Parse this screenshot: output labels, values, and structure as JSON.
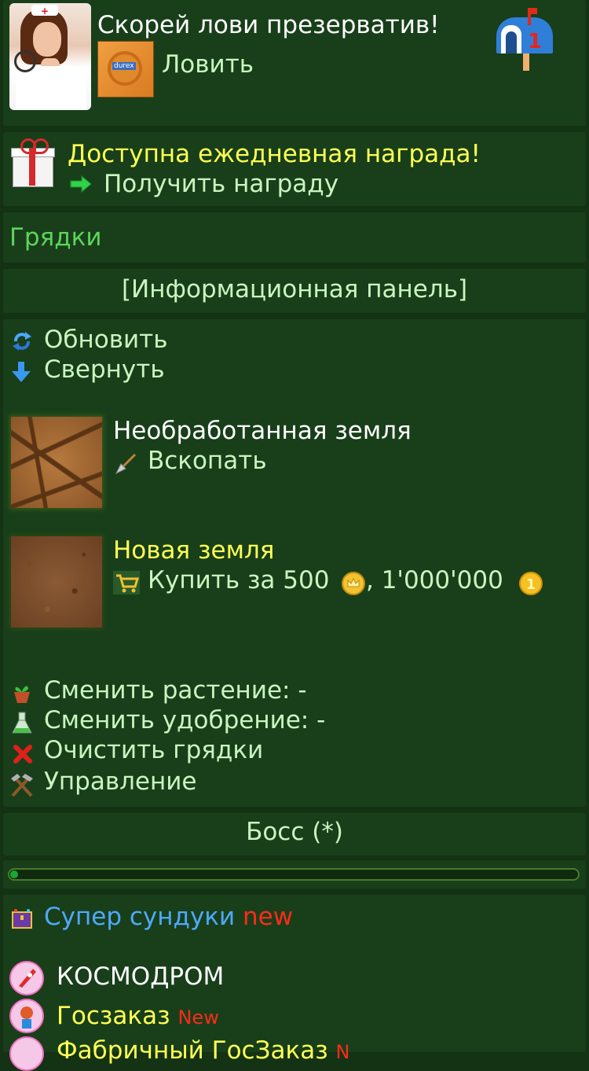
{
  "header": {
    "title": "Скорей лови презерватив!",
    "catch_label": "Ловить",
    "condom_brand": "durex",
    "mail_count": "1"
  },
  "daily": {
    "title": "Доступна ежедневная награда!",
    "link": "Получить награду"
  },
  "section_title": "Грядки",
  "info_panel_label": "[Информационная панель]",
  "actions": {
    "refresh": "Обновить",
    "collapse": "Свернуть"
  },
  "plots": [
    {
      "title": "Необработанная земля",
      "action": "Вскопать"
    },
    {
      "title": "Новая земля",
      "action_prefix": "Купить за 500",
      "action_mid": ", 1'000'000"
    }
  ],
  "bed_actions": {
    "change_plant": "Сменить растение: -",
    "change_fertilizer": "Сменить удобрение: -",
    "clear": "Очистить грядки",
    "manage": "Управление"
  },
  "boss": {
    "label": "Босс (*)",
    "progress": 0.012
  },
  "menu": {
    "super_chests": "Супер сундуки",
    "super_chests_badge": "new",
    "cosmodrome": "КОСМОДРОМ",
    "goszakaz": "Госзаказ",
    "goszakaz_badge": "New",
    "factory": "Фабричный ГосЗаказ",
    "factory_badge": "N"
  },
  "colors": {
    "background": "#143214",
    "panel": "#183f1a",
    "text_light": "#c9f5c0",
    "yellow": "#ffff55",
    "green": "#5fd35a",
    "blue": "#4fa8ff",
    "red": "#ff2a1a"
  }
}
